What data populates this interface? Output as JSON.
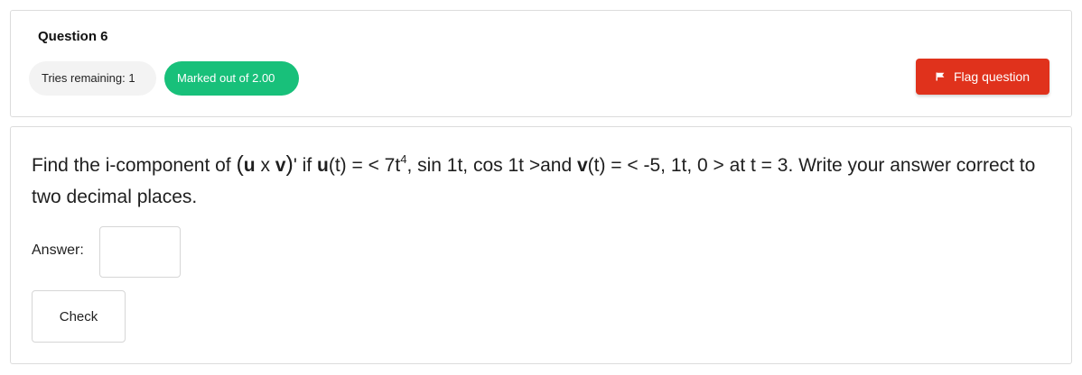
{
  "info": {
    "title": "Question 6",
    "tries": "Tries remaining: 1",
    "marked": "Marked out of 2.00",
    "flag_label": "Flag question",
    "flag_icon": "flag-icon",
    "marked_color": "#18c07a",
    "flag_color": "#e0321c"
  },
  "question": {
    "t1": "Find the i-component of ",
    "p_open": "(",
    "u1": "u",
    "x": " x ",
    "v1": "v",
    "p_close": ")",
    "t2": "' if ",
    "u2": "u",
    "t3": "(t) = < 7t",
    "exp": "4",
    "t4": ", sin 1t, cos 1t >and ",
    "v2": "v",
    "t5": "(t) = < -5, 1t, 0 > at t = 3. Write your answer correct to two decimal places."
  },
  "answer": {
    "label": "Answer:",
    "value": ""
  },
  "check_label": "Check"
}
